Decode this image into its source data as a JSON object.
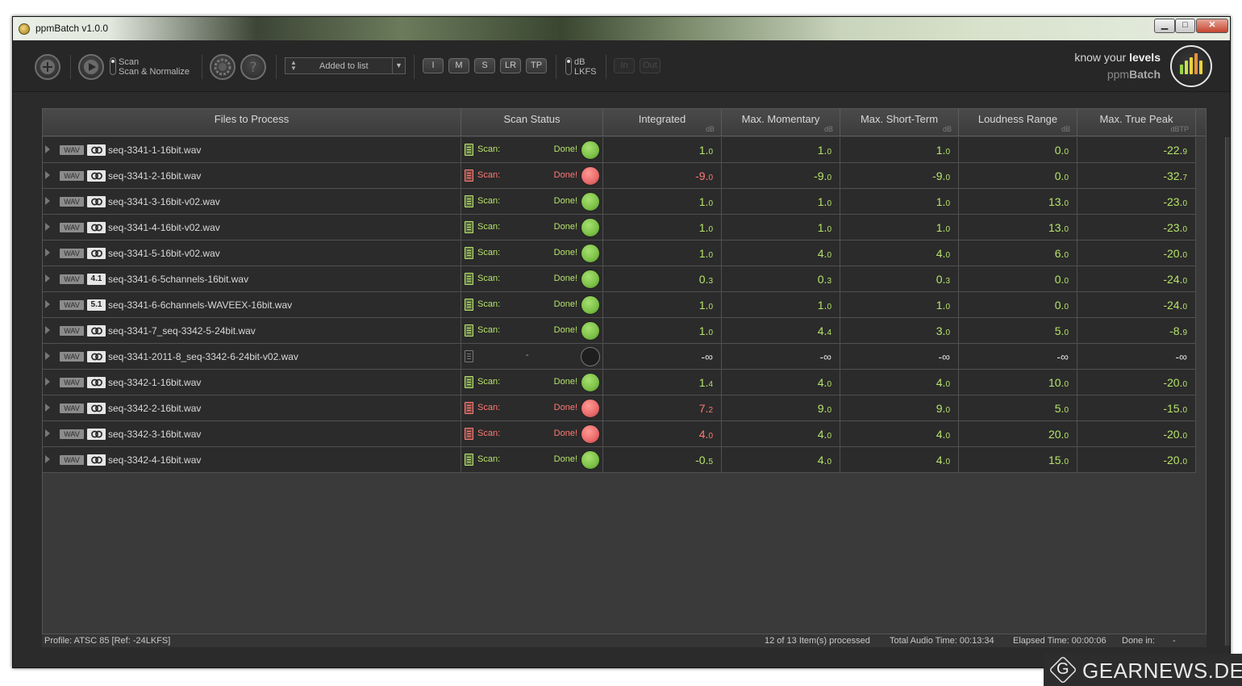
{
  "window": {
    "title": "ppmBatch  v1.0.0",
    "controls": {
      "minimize": "▁",
      "maximize": "□",
      "close": "✕"
    }
  },
  "toolbar": {
    "add_icon": "plus-circle-icon",
    "play_icon": "play-circle-icon",
    "mode_options": [
      "Scan",
      "Scan & Normalize"
    ],
    "mode_selected": "Scan",
    "settings_icon": "gear-icon",
    "help_icon": "question-circle-icon",
    "sort_dropdown_value": "Added to list",
    "meter_buttons": [
      "I",
      "M",
      "S",
      "LR",
      "TP"
    ],
    "unit_options": [
      "dB",
      "LKFS"
    ],
    "unit_selected": "dB",
    "io_buttons": [
      "In",
      "Out"
    ],
    "tagline_prefix": "know your ",
    "tagline_bold": "levels",
    "brand_prefix": "ppm",
    "brand_bold": "Batch"
  },
  "colors": {
    "green": "#b6e36b",
    "red": "#ff7a73",
    "led_green": "#7cc046",
    "led_red": "#e86a6a"
  },
  "table": {
    "columns": [
      {
        "label": "Files to Process",
        "unit": ""
      },
      {
        "label": "Scan Status",
        "unit": ""
      },
      {
        "label": "Integrated",
        "unit": "dB"
      },
      {
        "label": "Max. Momentary",
        "unit": "dB"
      },
      {
        "label": "Max. Short-Term",
        "unit": "dB"
      },
      {
        "label": "Loudness Range",
        "unit": "dB"
      },
      {
        "label": "Max. True Peak",
        "unit": "dBTP"
      }
    ],
    "rows": [
      {
        "format": "WAV",
        "channels": "stereo",
        "file": "seq-3341-1-16bit.wav",
        "status": "ok",
        "scan": "Scan:",
        "done": "Done!",
        "values": [
          [
            "1.",
            "0"
          ],
          [
            "1.",
            "0"
          ],
          [
            "1.",
            "0"
          ],
          [
            "0.",
            "0"
          ],
          [
            "-22.",
            "9"
          ]
        ]
      },
      {
        "format": "WAV",
        "channels": "stereo",
        "file": "seq-3341-2-16bit.wav",
        "status": "fail",
        "scan": "Scan:",
        "done": "Done!",
        "values": [
          [
            "-9.",
            "0"
          ],
          [
            "-9.",
            "0"
          ],
          [
            "-9.",
            "0"
          ],
          [
            "0.",
            "0"
          ],
          [
            "-32.",
            "7"
          ]
        ],
        "red_cols": [
          0
        ]
      },
      {
        "format": "WAV",
        "channels": "stereo",
        "file": "seq-3341-3-16bit-v02.wav",
        "status": "ok",
        "scan": "Scan:",
        "done": "Done!",
        "values": [
          [
            "1.",
            "0"
          ],
          [
            "1.",
            "0"
          ],
          [
            "1.",
            "0"
          ],
          [
            "13.",
            "0"
          ],
          [
            "-23.",
            "0"
          ]
        ]
      },
      {
        "format": "WAV",
        "channels": "stereo",
        "file": "seq-3341-4-16bit-v02.wav",
        "status": "ok",
        "scan": "Scan:",
        "done": "Done!",
        "values": [
          [
            "1.",
            "0"
          ],
          [
            "1.",
            "0"
          ],
          [
            "1.",
            "0"
          ],
          [
            "13.",
            "0"
          ],
          [
            "-23.",
            "0"
          ]
        ]
      },
      {
        "format": "WAV",
        "channels": "stereo",
        "file": "seq-3341-5-16bit-v02.wav",
        "status": "ok",
        "scan": "Scan:",
        "done": "Done!",
        "values": [
          [
            "1.",
            "0"
          ],
          [
            "4.",
            "0"
          ],
          [
            "4.",
            "0"
          ],
          [
            "6.",
            "0"
          ],
          [
            "-20.",
            "0"
          ]
        ]
      },
      {
        "format": "WAV",
        "channels": "4.1",
        "file": "seq-3341-6-5channels-16bit.wav",
        "status": "ok",
        "scan": "Scan:",
        "done": "Done!",
        "values": [
          [
            "0.",
            "3"
          ],
          [
            "0.",
            "3"
          ],
          [
            "0.",
            "3"
          ],
          [
            "0.",
            "0"
          ],
          [
            "-24.",
            "0"
          ]
        ]
      },
      {
        "format": "WAV",
        "channels": "5.1",
        "file": "seq-3341-6-6channels-WAVEEX-16bit.wav",
        "status": "ok",
        "scan": "Scan:",
        "done": "Done!",
        "values": [
          [
            "1.",
            "0"
          ],
          [
            "1.",
            "0"
          ],
          [
            "1.",
            "0"
          ],
          [
            "0.",
            "0"
          ],
          [
            "-24.",
            "0"
          ]
        ]
      },
      {
        "format": "WAV",
        "channels": "stereo",
        "file": "seq-3341-7_seq-3342-5-24bit.wav",
        "status": "ok",
        "scan": "Scan:",
        "done": "Done!",
        "values": [
          [
            "1.",
            "0"
          ],
          [
            "4.",
            "4"
          ],
          [
            "3.",
            "0"
          ],
          [
            "5.",
            "0"
          ],
          [
            "-8.",
            "9"
          ]
        ]
      },
      {
        "format": "WAV",
        "channels": "stereo",
        "file": "seq-3341-2011-8_seq-3342-6-24bit-v02.wav",
        "status": "none",
        "scan": "",
        "done": "-",
        "values": [
          [
            "-∞",
            ""
          ],
          [
            "-∞",
            ""
          ],
          [
            "-∞",
            ""
          ],
          [
            "-∞",
            ""
          ],
          [
            "-∞",
            ""
          ]
        ]
      },
      {
        "format": "WAV",
        "channels": "stereo",
        "file": "seq-3342-1-16bit.wav",
        "status": "ok",
        "scan": "Scan:",
        "done": "Done!",
        "values": [
          [
            "1.",
            "4"
          ],
          [
            "4.",
            "0"
          ],
          [
            "4.",
            "0"
          ],
          [
            "10.",
            "0"
          ],
          [
            "-20.",
            "0"
          ]
        ]
      },
      {
        "format": "WAV",
        "channels": "stereo",
        "file": "seq-3342-2-16bit.wav",
        "status": "fail",
        "scan": "Scan:",
        "done": "Done!",
        "values": [
          [
            "7.",
            "2"
          ],
          [
            "9.",
            "0"
          ],
          [
            "9.",
            "0"
          ],
          [
            "5.",
            "0"
          ],
          [
            "-15.",
            "0"
          ]
        ],
        "red_cols": [
          0
        ]
      },
      {
        "format": "WAV",
        "channels": "stereo",
        "file": "seq-3342-3-16bit.wav",
        "status": "fail",
        "scan": "Scan:",
        "done": "Done!",
        "values": [
          [
            "4.",
            "0"
          ],
          [
            "4.",
            "0"
          ],
          [
            "4.",
            "0"
          ],
          [
            "20.",
            "0"
          ],
          [
            "-20.",
            "0"
          ]
        ],
        "red_cols": [
          0
        ]
      },
      {
        "format": "WAV",
        "channels": "stereo",
        "file": "seq-3342-4-16bit.wav",
        "status": "ok",
        "scan": "Scan:",
        "done": "Done!",
        "values": [
          [
            "-0.",
            "5"
          ],
          [
            "4.",
            "0"
          ],
          [
            "4.",
            "0"
          ],
          [
            "15.",
            "0"
          ],
          [
            "-20.",
            "0"
          ]
        ]
      }
    ]
  },
  "statusbar": {
    "profile": "Profile: ATSC 85 [Ref: -24LKFS]",
    "processed": "12 of 13 Item(s) processed",
    "total_audio": "Total Audio Time: 00:13:34",
    "elapsed": "Elapsed Time: 00:00:06",
    "done_in_label": "Done in:",
    "done_in_value": "-"
  },
  "watermark": {
    "letter": "G",
    "text": "GEARNEWS.DE"
  }
}
